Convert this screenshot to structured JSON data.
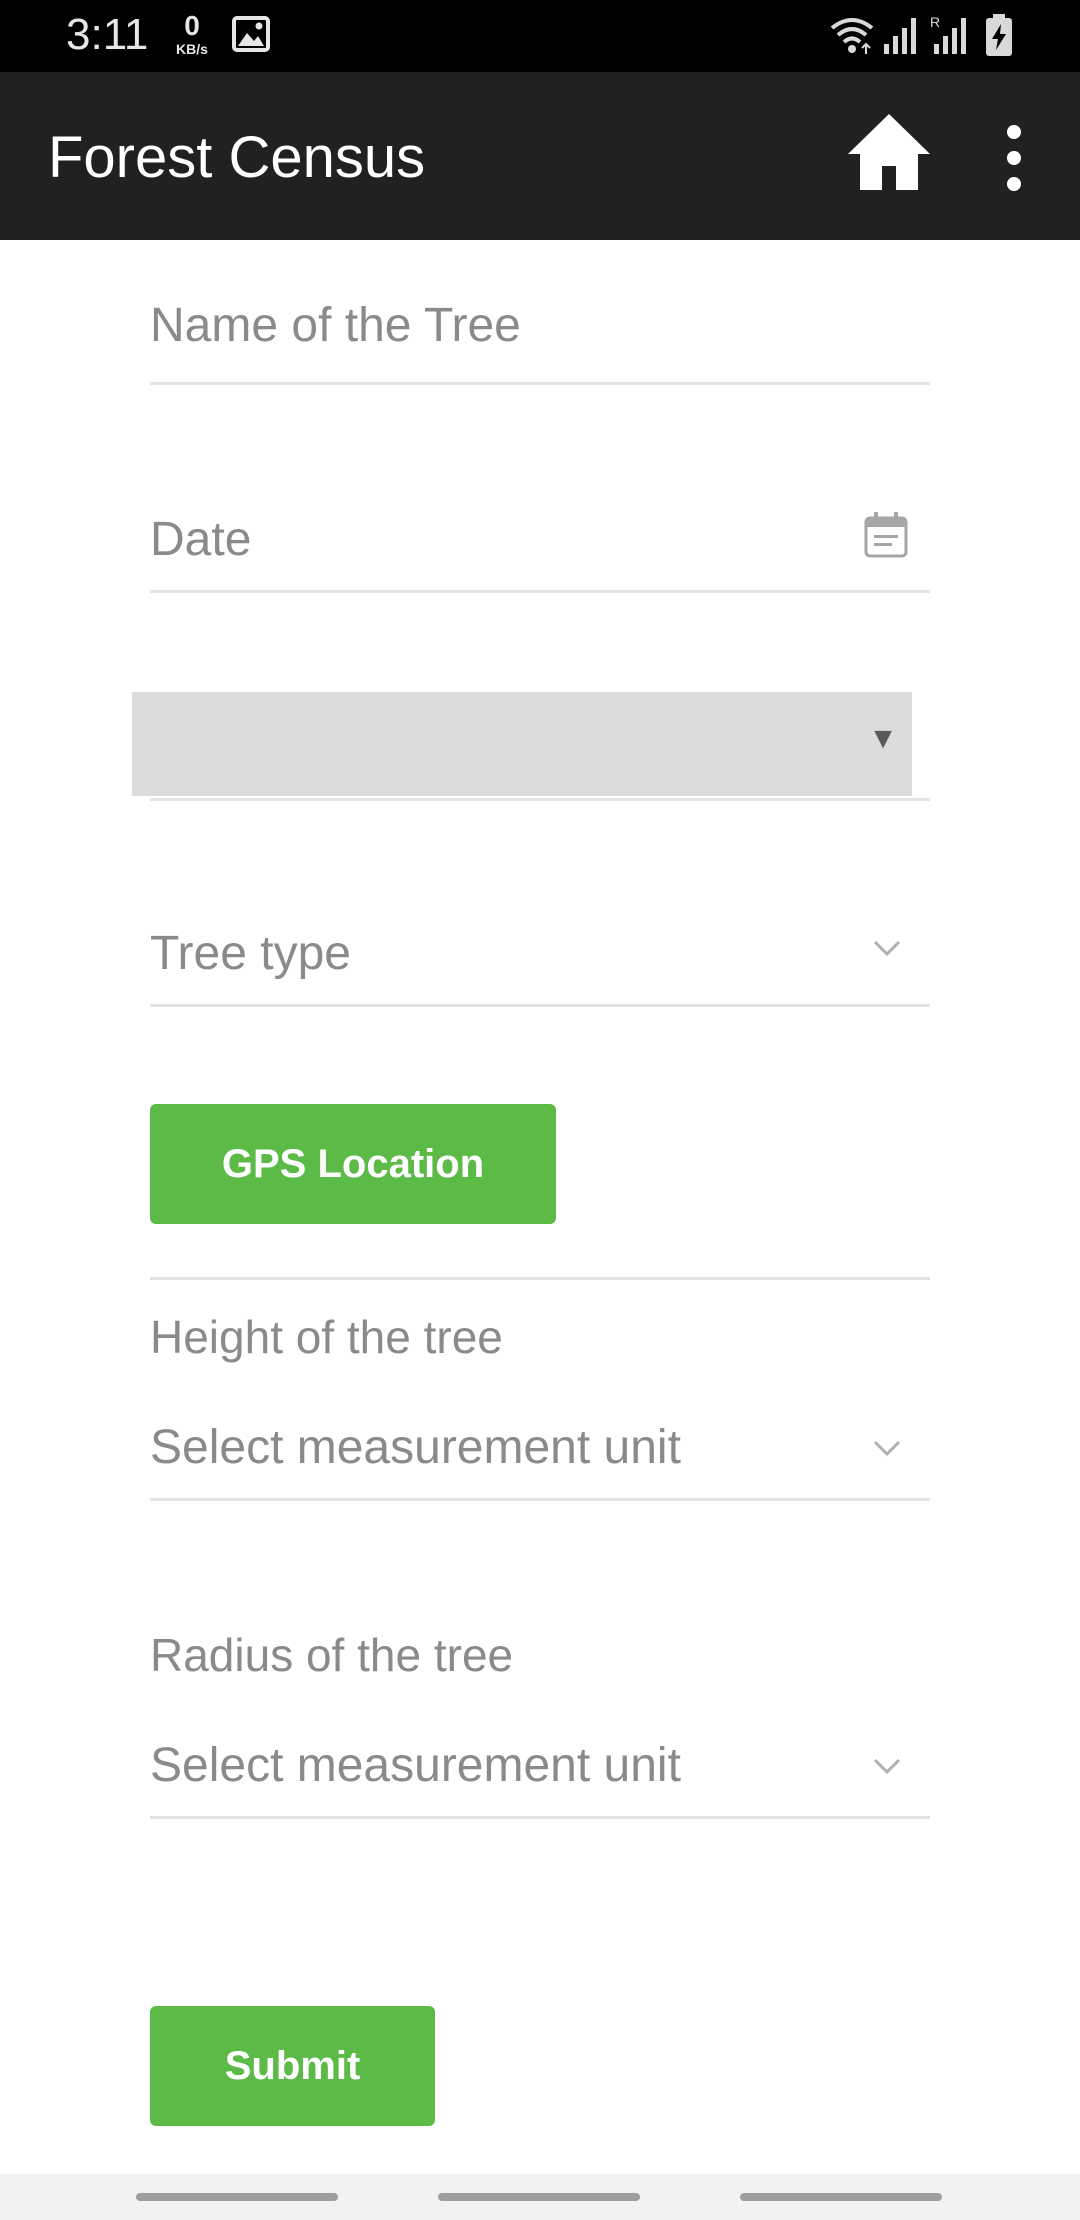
{
  "status_bar": {
    "time": "3:11",
    "net_speed_value": "0",
    "net_speed_unit": "KB/s",
    "icons": [
      "gallery-icon",
      "wifi-icon",
      "signal-icon",
      "signal-roaming-icon",
      "battery-charging-icon"
    ],
    "roaming_label": "R"
  },
  "app_bar": {
    "title": "Forest Census",
    "home_icon": "home-icon",
    "menu_icon": "more-vert-icon"
  },
  "form": {
    "tree_name_placeholder": "Name of the Tree",
    "date_placeholder": "Date",
    "date_icon": "calendar-icon",
    "spinner_value": "",
    "spinner_arrow": "▼",
    "tree_type_placeholder": "Tree type",
    "gps_button_label": "GPS Location",
    "height_label": "Height of the tree",
    "height_unit_placeholder": "Select measurement unit",
    "radius_label": "Radius of the tree",
    "radius_unit_placeholder": "Select measurement unit",
    "submit_button_label": "Submit"
  },
  "colors": {
    "app_bar": "#212121",
    "accent_green": "#5cba47",
    "spinner_bg": "#dcdcdc",
    "hint_text": "#8a8a8a"
  }
}
